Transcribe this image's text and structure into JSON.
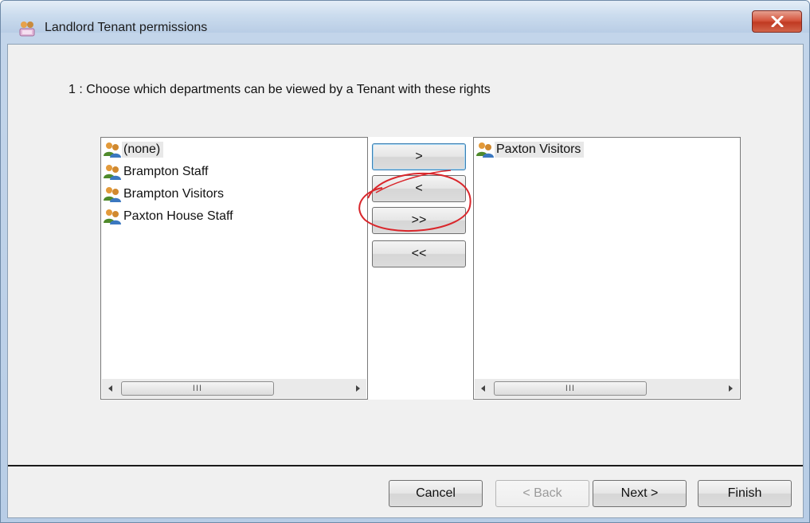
{
  "window": {
    "title": "Landlord Tenant permissions"
  },
  "instruction": "1 : Choose which departments can be viewed by a Tenant with these rights",
  "available_list": {
    "items": [
      "(none)",
      "Brampton Staff",
      "Brampton Visitors",
      "Paxton House Staff"
    ],
    "selected_index": 0
  },
  "selected_list": {
    "items": [
      "Paxton Visitors"
    ]
  },
  "move_buttons": {
    "add": ">",
    "remove": "<",
    "add_all": ">>",
    "remove_all": "<<"
  },
  "footer": {
    "cancel": "Cancel",
    "back": "< Back",
    "next": "Next >",
    "finish": "Finish"
  },
  "scroll_grip": "III",
  "colors": {
    "annotation": "#d9262b",
    "close_button": "#c8452e",
    "focus_border": "#3c7fb1"
  },
  "icons": [
    "user-group-icon",
    "close-icon",
    "scroll-left-arrow-icon",
    "scroll-right-arrow-icon"
  ]
}
